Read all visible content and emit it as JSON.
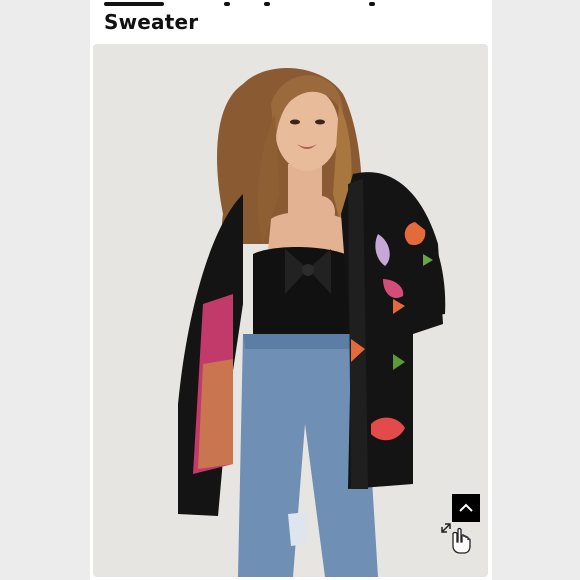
{
  "product": {
    "title": "Sweater"
  },
  "controls": {
    "scroll_top_icon": "chevron-up-icon",
    "zoom_icon": "hand-expand-icon"
  },
  "colors": {
    "card_bg": "#ffffff",
    "photo_bg": "#e6e4e1",
    "sweater": "#141414",
    "button_bg": "#000000"
  }
}
